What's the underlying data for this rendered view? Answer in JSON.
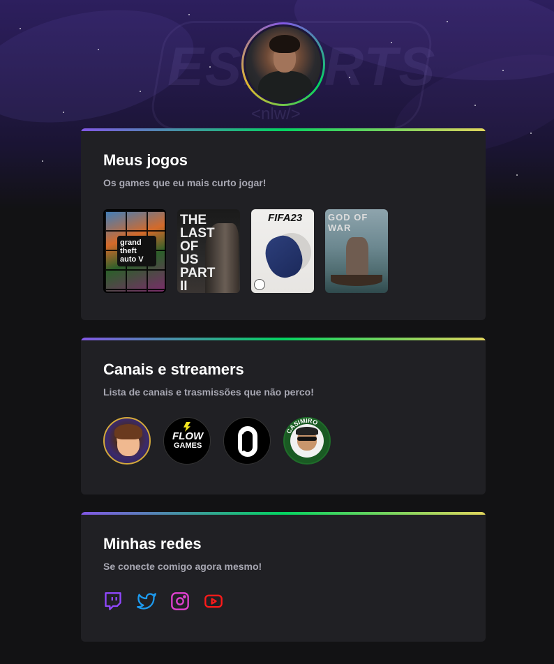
{
  "background": {
    "logo_text": "ESPORTS",
    "logo_sub": "<nlw/>"
  },
  "games_section": {
    "title": "Meus jogos",
    "subtitle": "Os games que eu mais curto jogar!",
    "games": [
      {
        "name": "gta-v",
        "cover_text": "grand theft auto V"
      },
      {
        "name": "the-last-of-us-part-ii",
        "cover_text": "THE LAST OF US PART II"
      },
      {
        "name": "fifa-23",
        "cover_text": "FIFA23"
      },
      {
        "name": "god-of-war",
        "cover_text": "GOD OF WAR"
      }
    ]
  },
  "streamers_section": {
    "title": "Canais e streamers",
    "subtitle": "Lista de canais e trasmissões que não perco!",
    "streamers": [
      {
        "name": "streamer-cartoon-avatar",
        "badge_text": ""
      },
      {
        "name": "flow-games",
        "badge_text_1": "FLOW",
        "badge_text_2": "GAMES"
      },
      {
        "name": "omelete-style-logo",
        "badge_text": ""
      },
      {
        "name": "casimiro",
        "badge_text": "CASIMIRO"
      }
    ]
  },
  "socials_section": {
    "title": "Minhas redes",
    "subtitle": "Se conecte comigo agora mesmo!",
    "icons": [
      {
        "name": "twitch-icon",
        "color": "#9147ff"
      },
      {
        "name": "twitter-icon",
        "color": "#1d9bf0"
      },
      {
        "name": "instagram-icon",
        "color": "#e040d0"
      },
      {
        "name": "youtube-icon",
        "color": "#ff0000"
      }
    ]
  },
  "colors": {
    "page_bg": "#121214",
    "card_bg": "#202024",
    "subtitle": "#a8a8b3",
    "gradient": [
      "#8257e5",
      "#04d361",
      "#e1d55d"
    ]
  }
}
